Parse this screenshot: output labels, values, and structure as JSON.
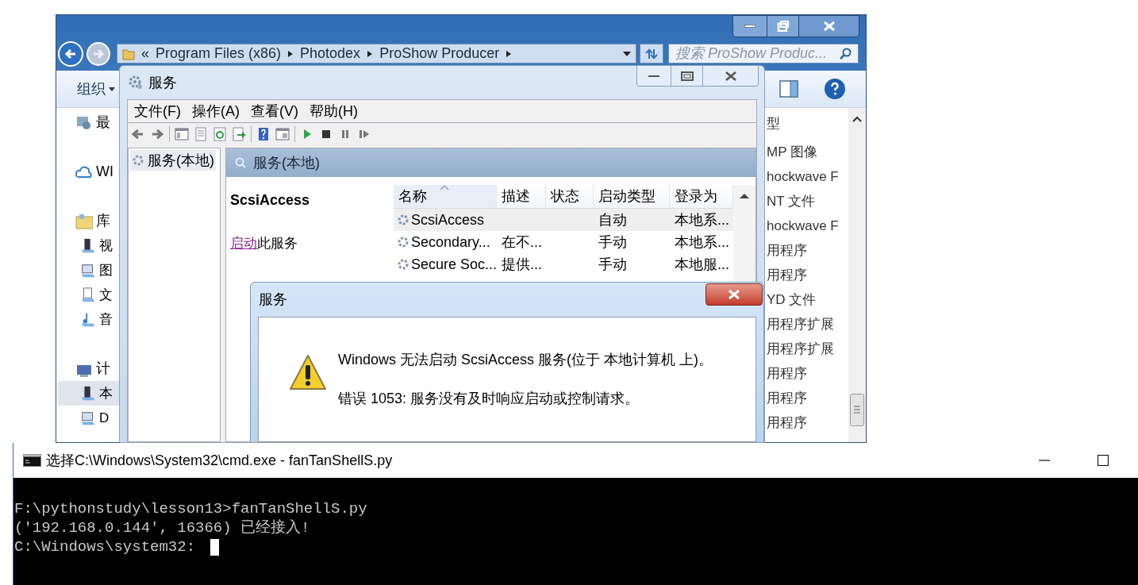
{
  "explorer": {
    "address": {
      "overflow": "«",
      "crumbs": [
        "Program Files (x86)",
        "Photodex",
        "ProShow Producer"
      ]
    },
    "search": {
      "placeholder": "搜索 ProShow Produc..."
    },
    "toolbar": {
      "organize": "组织"
    },
    "nav": [
      {
        "label": "最",
        "selected": false
      },
      {
        "label": "WI",
        "selected": false
      },
      {
        "label": "库",
        "selected": false,
        "children": [
          {
            "label": "视",
            "selected": false
          },
          {
            "label": "图",
            "selected": false
          },
          {
            "label": "文",
            "selected": false
          },
          {
            "label": "音",
            "selected": false
          }
        ]
      },
      {
        "label": "计",
        "selected": false,
        "children": [
          {
            "label": "本",
            "selected": true
          },
          {
            "label": "D",
            "selected": false
          }
        ]
      }
    ],
    "type_column": {
      "header": "型",
      "rows": [
        "MP 图像",
        "hockwave F",
        "NT 文件",
        "hockwave F",
        "用程序",
        "用程序",
        "YD 文件",
        "用程序扩展",
        "用程序扩展",
        "用程序",
        "用程序",
        "用程序"
      ]
    }
  },
  "services_window": {
    "title": "服务",
    "menu": [
      "文件(F)",
      "操作(A)",
      "查看(V)",
      "帮助(H)"
    ],
    "tree": [
      {
        "label": "服务(本地)",
        "selected": true
      }
    ],
    "header": "服务(本地)",
    "detail": {
      "name": "ScsiAccess",
      "link": "启动",
      "action": "此服务"
    },
    "table": {
      "columns": [
        {
          "label": "名称",
          "sorted": true
        },
        {
          "label": "描述",
          "sorted": false
        },
        {
          "label": "状态",
          "sorted": false
        },
        {
          "label": "启动类型",
          "sorted": false
        },
        {
          "label": "登录为",
          "sorted": false
        }
      ],
      "rows": [
        {
          "name": "ScsiAccess",
          "startup": "自动",
          "logon": "本地系...",
          "selected": true
        },
        {
          "name": "Secondary...",
          "description": "在不...",
          "startup": "手动",
          "logon": "本地系...",
          "selected": false
        },
        {
          "name": "Secure Soc...",
          "description": "提供...",
          "startup": "手动",
          "logon": "本地服...",
          "selected": false
        }
      ]
    }
  },
  "dialog": {
    "title": "服务",
    "message": "Windows 无法启动 ScsiAccess 服务(位于 本地计算机 上)。",
    "error": "错误 1053: 服务没有及时响应启动或控制请求。"
  },
  "console": {
    "title": "选择C:\\Windows\\System32\\cmd.exe - fanTanShellS.py",
    "lines": [
      "F:\\pythonstudy\\lesson13>fanTanShellS.py",
      "('192.168.0.144', 16366) 已经接入!",
      "C:\\Windows\\system32: "
    ]
  }
}
